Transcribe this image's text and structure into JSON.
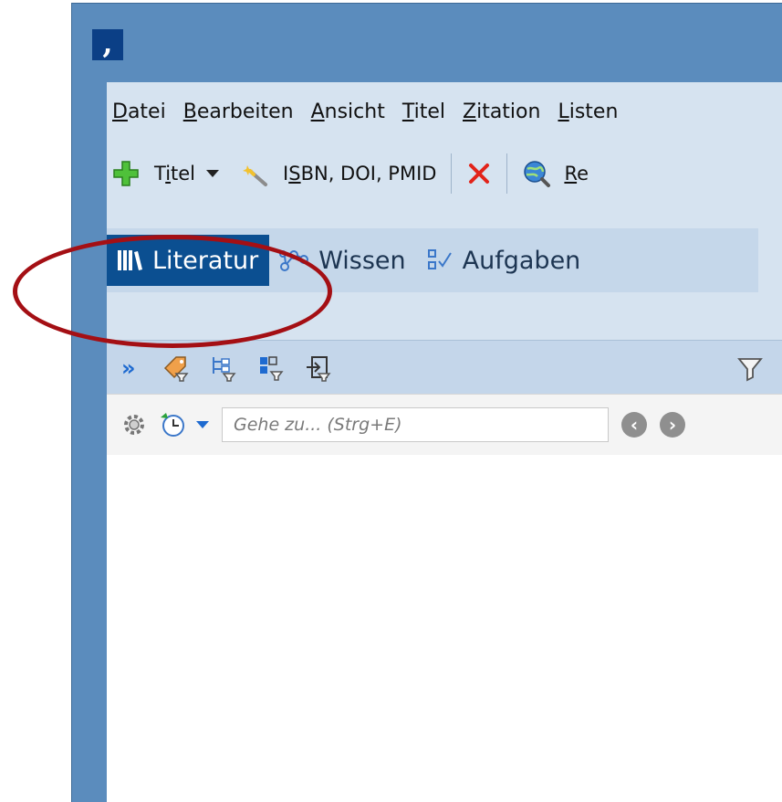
{
  "app": {
    "logo_glyph": ","
  },
  "menubar": {
    "items": [
      {
        "pre": "",
        "u": "D",
        "post": "atei"
      },
      {
        "pre": "",
        "u": "B",
        "post": "earbeiten"
      },
      {
        "pre": "",
        "u": "A",
        "post": "nsicht"
      },
      {
        "pre": "",
        "u": "T",
        "post": "itel"
      },
      {
        "pre": "",
        "u": "Z",
        "post": "itation"
      },
      {
        "pre": "",
        "u": "L",
        "post": "isten"
      }
    ]
  },
  "toolbar": {
    "add_title": {
      "pre": "T",
      "u": "i",
      "post": "tel"
    },
    "isbn": {
      "pre": "I",
      "u": "S",
      "post": "BN, DOI, PMID"
    },
    "research": {
      "pre": "",
      "u": "R",
      "post": "e"
    }
  },
  "modes": {
    "literatur": "Literatur",
    "wissen": "Wissen",
    "aufgaben": "Aufgaben"
  },
  "search": {
    "placeholder": "Gehe zu... (Strg+E)"
  },
  "colors": {
    "window_border": "#5b8cbd",
    "client_bg": "#d6e3f0",
    "active_tab": "#0b4f91",
    "highlight_ring": "#a40f14"
  }
}
